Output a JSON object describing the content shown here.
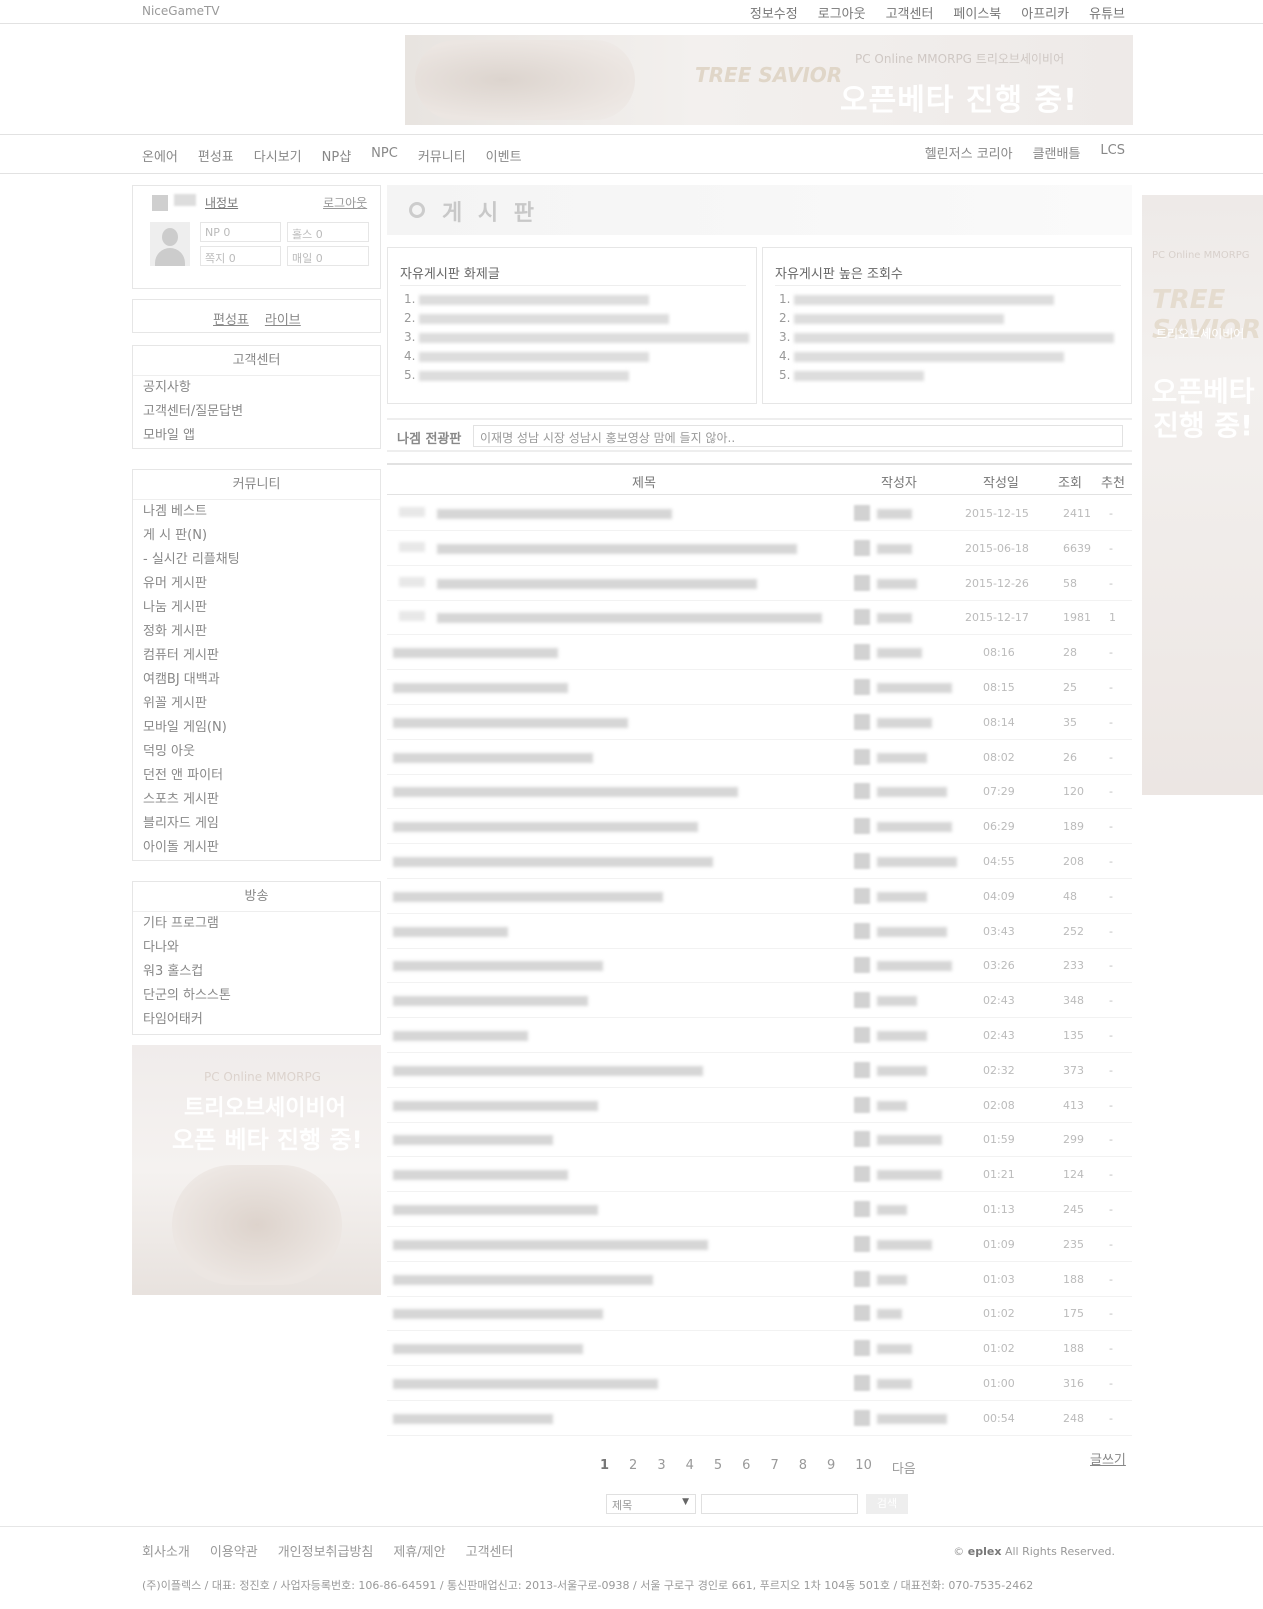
{
  "top": {
    "logo": "NiceGameTV",
    "nav": [
      "정보수정",
      "로그아웃",
      "고객센터",
      "페이스북",
      "아프리카",
      "유튜브"
    ]
  },
  "banner": {
    "logo": "TREE SAVIOR",
    "sub": "PC Online MMORPG  트리오브세이비어",
    "main": "오픈베타 진행 중!"
  },
  "menu": {
    "main": [
      "온에어",
      "편성표",
      "다시보기",
      "NP샵",
      "NPC",
      "커뮤니티",
      "이벤트"
    ],
    "right": [
      "헬린저스 코리아",
      "클랜배틀",
      "LCS"
    ]
  },
  "login": {
    "myinfo": "내정보",
    "logout": "로그아웃",
    "stats": [
      "NP 0",
      "홀스 0",
      "쪽지 0",
      "매일 0"
    ]
  },
  "links": {
    "schedule": "편성표",
    "live": "라이브"
  },
  "support": {
    "title": "고객센터",
    "items": [
      "공지사항",
      "고객센터/질문답변",
      "모바일 앱"
    ]
  },
  "community": {
    "title": "커뮤니티",
    "items": [
      "나겜 베스트",
      "게 시 판(N)",
      "- 실시간 리플채팅",
      "유머 게시판",
      "나눔 게시판",
      "정화 게시판",
      "컴퓨터 게시판",
      "여캠BJ 대백과",
      "위꼴 게시판",
      "모바일 게임(N)",
      "덕밍 아웃",
      "던전 앤 파이터",
      "스포츠 게시판",
      "블리자드 게임",
      "아이돌 게시판"
    ]
  },
  "broadcast": {
    "title": "방송",
    "items": [
      "기타 프로그램",
      "다나와",
      "워3 홀스컵",
      "단군의 하스스톤",
      "타임어태커"
    ]
  },
  "side_ad": {
    "sub": "PC Online MMORPG",
    "line1": "트리오브세이비어",
    "line2": "오픈 베타 진행 중!"
  },
  "right_ad": {
    "sub": "PC Online MMORPG",
    "logo": "TREE SAVIOR",
    "name": "트리오브세이비어",
    "main": "오픈베타 진행 중!"
  },
  "board": {
    "title": "게 시 판"
  },
  "hot": [
    {
      "title": "자유게시판 화제글",
      "nums": [
        "1.",
        "2.",
        "3.",
        "4.",
        "5."
      ]
    },
    {
      "title": "자유게시판 높은 조회수",
      "nums": [
        "1.",
        "2.",
        "3.",
        "4.",
        "5."
      ]
    }
  ],
  "notice": {
    "label": "나겜 전광판",
    "text": "이재명 성남 시장 성남시 홍보영상 맘에 들지 않아.."
  },
  "table": {
    "headers": [
      "제목",
      "작성자",
      "작성일",
      "조회",
      "추천"
    ]
  },
  "rows": [
    {
      "date": "2015-12-15",
      "views": "2411",
      "rec": "-"
    },
    {
      "date": "2015-06-18",
      "views": "6639",
      "rec": "-"
    },
    {
      "date": "2015-12-26",
      "views": "58",
      "rec": "-"
    },
    {
      "date": "2015-12-17",
      "views": "1981",
      "rec": "1"
    },
    {
      "date": "08:16",
      "views": "28",
      "rec": "-"
    },
    {
      "date": "08:15",
      "views": "25",
      "rec": "-"
    },
    {
      "date": "08:14",
      "views": "35",
      "rec": "-"
    },
    {
      "date": "08:02",
      "views": "26",
      "rec": "-"
    },
    {
      "date": "07:29",
      "views": "120",
      "rec": "-"
    },
    {
      "date": "06:29",
      "views": "189",
      "rec": "-"
    },
    {
      "date": "04:55",
      "views": "208",
      "rec": "-"
    },
    {
      "date": "04:09",
      "views": "48",
      "rec": "-"
    },
    {
      "date": "03:43",
      "views": "252",
      "rec": "-"
    },
    {
      "date": "03:26",
      "views": "233",
      "rec": "-"
    },
    {
      "date": "02:43",
      "views": "348",
      "rec": "-"
    },
    {
      "date": "02:43",
      "views": "135",
      "rec": "-"
    },
    {
      "date": "02:32",
      "views": "373",
      "rec": "-"
    },
    {
      "date": "02:08",
      "views": "413",
      "rec": "-"
    },
    {
      "date": "01:59",
      "views": "299",
      "rec": "-"
    },
    {
      "date": "01:21",
      "views": "124",
      "rec": "-"
    },
    {
      "date": "01:13",
      "views": "245",
      "rec": "-"
    },
    {
      "date": "01:09",
      "views": "235",
      "rec": "-"
    },
    {
      "date": "01:03",
      "views": "188",
      "rec": "-"
    },
    {
      "date": "01:02",
      "views": "175",
      "rec": "-"
    },
    {
      "date": "01:02",
      "views": "188",
      "rec": "-"
    },
    {
      "date": "01:00",
      "views": "316",
      "rec": "-"
    },
    {
      "date": "00:54",
      "views": "248",
      "rec": "-"
    }
  ],
  "pager": {
    "pages": [
      "1",
      "2",
      "3",
      "4",
      "5",
      "6",
      "7",
      "8",
      "9",
      "10"
    ],
    "next": "다음",
    "write": "글쓰기"
  },
  "search": {
    "select": "제목",
    "button": "검색"
  },
  "footer": {
    "nav": [
      "회사소개",
      "이용약관",
      "개인정보취급방침",
      "제휴/제안",
      "고객센터"
    ],
    "brand": "eplex",
    "copy": "All Rights Reserved.",
    "address": "(주)이플렉스 / 대표: 정진호 / 사업자등록번호: 106-86-64591 / 통신판매업신고: 2013-서울구로-0938 / 서울 구로구 경인로 661, 푸르지오 1차 104동 501호 / 대표전화: 070-7535-2462"
  }
}
